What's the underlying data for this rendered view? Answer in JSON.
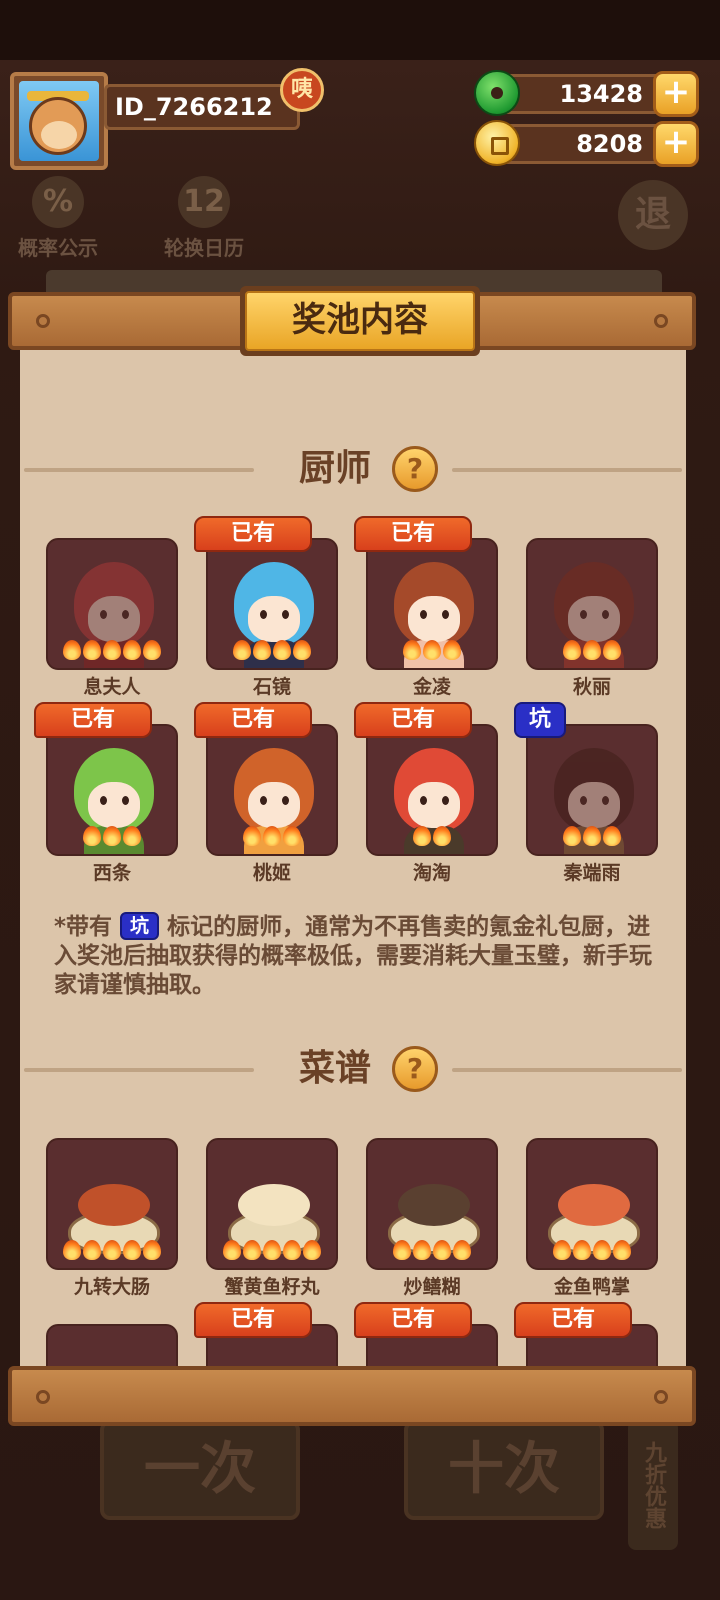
{
  "background": {
    "tools": [
      {
        "label": "概率公示",
        "glyph": "%"
      },
      {
        "label": "轮换日历",
        "glyph": "12"
      }
    ],
    "exit_glyph": "退",
    "bottom_buttons": [
      "一次",
      "十次"
    ],
    "side_tag": "九折优惠"
  },
  "player": {
    "id": "ID_7266212",
    "badge": "咦"
  },
  "currency": {
    "jade": "13428",
    "coins": "8208",
    "plus": "+"
  },
  "panel": {
    "title": "奖池内容",
    "chef_section": {
      "label": "厨师",
      "help": "?"
    },
    "recipe_section": {
      "label": "菜谱",
      "help": "?"
    }
  },
  "badges": {
    "owned": "已有",
    "pit": "坑"
  },
  "chefs": [
    {
      "name": "息夫人",
      "owned": false,
      "pit": false,
      "stars": 5,
      "dim": true,
      "hair": "#b83a3a",
      "outfit": "#8a2020"
    },
    {
      "name": "石镜",
      "owned": true,
      "pit": false,
      "stars": 4,
      "dim": false,
      "hair": "#4fb6e6",
      "outfit": "#2e2f4a"
    },
    {
      "name": "金凌",
      "owned": true,
      "pit": false,
      "stars": 3,
      "dim": false,
      "hair": "#a54a2a",
      "outfit": "#f0c0a8"
    },
    {
      "name": "秋丽",
      "owned": false,
      "pit": false,
      "stars": 3,
      "dim": true,
      "hair": "#7a2a1c",
      "outfit": "#b23a2a"
    },
    {
      "name": "西条",
      "owned": true,
      "pit": false,
      "stars": 3,
      "dim": false,
      "hair": "#7dc54a",
      "outfit": "#5a8a30"
    },
    {
      "name": "桃姬",
      "owned": true,
      "pit": false,
      "stars": 3,
      "dim": false,
      "hair": "#d0632a",
      "outfit": "#f0a040"
    },
    {
      "name": "淘淘",
      "owned": true,
      "pit": false,
      "stars": 2,
      "dim": false,
      "hair": "#e04a36",
      "outfit": "#4a3a2a"
    },
    {
      "name": "秦端雨",
      "owned": false,
      "pit": true,
      "stars": 3,
      "dim": true,
      "hair": "#3a1a14",
      "outfit": "#8a6a3a"
    }
  ],
  "note": {
    "prefix": "*带有",
    "suffix": "标记的厨师，通常为不再售卖的氪金礼包厨，进入奖池后抽取获得的概率极低，需要消耗大量玉璧，新手玩家请谨慎抽取。"
  },
  "recipes": [
    {
      "name": "九转大肠",
      "stars": 5,
      "food": "#c0512a"
    },
    {
      "name": "蟹黄鱼籽丸",
      "stars": 5,
      "food": "#f3e3c0"
    },
    {
      "name": "炒鳝糊",
      "stars": 4,
      "food": "#5a4030"
    },
    {
      "name": "金鱼鸭掌",
      "stars": 4,
      "food": "#e06a40"
    }
  ],
  "recipes_row2": [
    {
      "owned": false
    },
    {
      "owned": true
    },
    {
      "owned": true
    },
    {
      "owned": true
    }
  ],
  "colors": {
    "panel_bg": "#dcc5aa",
    "tile_bg": "#5a2e2f",
    "owned_badge": "#e2542a",
    "pit_badge": "#2a2fc6",
    "title_gold": "#f5be47"
  }
}
